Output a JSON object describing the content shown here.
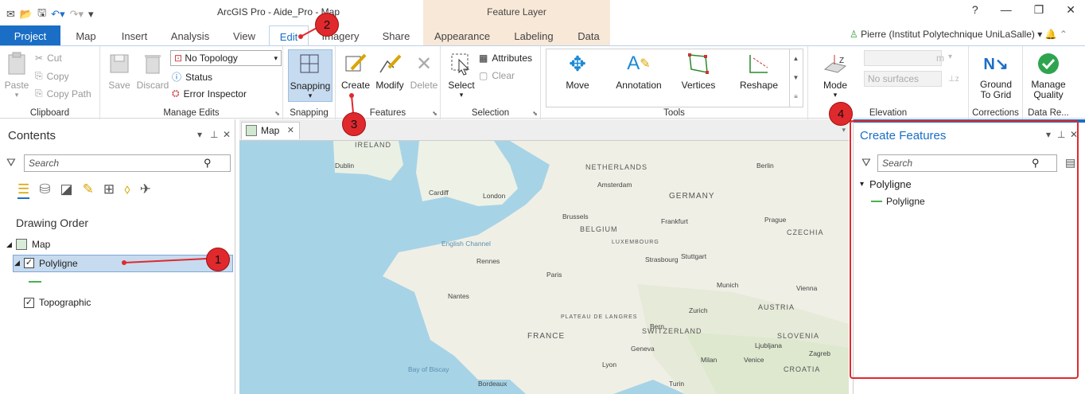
{
  "window": {
    "title": "ArcGIS Pro - Aide_Pro - Map",
    "context_tab_group": "Feature Layer",
    "user": "Pierre (Institut Polytechnique UniLaSalle)"
  },
  "tabs": [
    "Project",
    "Map",
    "Insert",
    "Analysis",
    "View",
    "Edit",
    "Imagery",
    "Share",
    "Appearance",
    "Labeling",
    "Data"
  ],
  "ribbon": {
    "clipboard": {
      "label": "Clipboard",
      "paste": "Paste",
      "cut": "Cut",
      "copy": "Copy",
      "copy_path": "Copy Path"
    },
    "manage_edits": {
      "label": "Manage Edits",
      "save": "Save",
      "discard": "Discard",
      "topology": "No Topology",
      "status": "Status",
      "error_inspector": "Error Inspector"
    },
    "snapping": {
      "label": "Snapping",
      "button": "Snapping"
    },
    "features": {
      "label": "Features",
      "create": "Create",
      "modify": "Modify",
      "delete": "Delete"
    },
    "selection": {
      "label": "Selection",
      "select": "Select",
      "attributes": "Attributes",
      "clear": "Clear"
    },
    "tools": {
      "label": "Tools",
      "move": "Move",
      "annotation": "Annotation",
      "vertices": "Vertices",
      "reshape": "Reshape"
    },
    "elevation": {
      "label": "Elevation",
      "mode": "Mode",
      "surfaces": "No surfaces",
      "unit": "m"
    },
    "corrections": {
      "label": "Corrections",
      "ground_to_grid": "Ground To Grid"
    },
    "data_reviewer": {
      "label": "Data Re...",
      "manage_quality": "Manage Quality"
    }
  },
  "contents": {
    "title": "Contents",
    "search_placeholder": "Search",
    "drawing_order": "Drawing Order",
    "map": "Map",
    "layer_polyligne": "Polyligne",
    "layer_topographic": "Topographic"
  },
  "map_view": {
    "tab": "Map",
    "labels": {
      "ireland": "IRELAND",
      "netherlands": "NETHERLANDS",
      "germany": "GERMANY",
      "belgium": "BELGIUM",
      "lux": "LUXEMBOURG",
      "czechia": "CZECHIA",
      "france": "FRANCE",
      "switz": "SWITZERLAND",
      "austria": "AUSTRIA",
      "slovenia": "SLOVENIA",
      "croatia": "CROATIA",
      "london": "London",
      "paris": "Paris",
      "munich": "Munich",
      "bern": "Bern",
      "berlin": "Berlin",
      "prague": "Prague",
      "amsterdam": "Amsterdam",
      "brussels": "Brussels",
      "english_channel": "English Channel",
      "bay_biscay": "Bay of Biscay",
      "plateau": "PLATEAU DE LANGRES",
      "cardiff": "Cardiff",
      "milan": "Milan",
      "vienna": "Vienna",
      "zagreb": "Zagreb",
      "frankfurt": "Frankfurt",
      "stuttgart": "Stuttgart",
      "strasbourg": "Strasbourg",
      "lyon": "Lyon",
      "bordeaux": "Bordeaux",
      "nantes": "Nantes",
      "rennes": "Rennes",
      "dublin": "Dublin",
      "ljubljana": "Ljubljana",
      "venice": "Venice",
      "turin": "Turin",
      "geneva": "Geneva",
      "zurich": "Zurich"
    }
  },
  "create_features": {
    "title": "Create Features",
    "search_placeholder": "Search",
    "group": "Polyligne",
    "template": "Polyligne"
  },
  "annotations": [
    "1",
    "2",
    "3",
    "4"
  ],
  "colors": {
    "accent": "#1a6ec5",
    "annotation": "#e0292d",
    "context_band": "#f8e8d8"
  }
}
